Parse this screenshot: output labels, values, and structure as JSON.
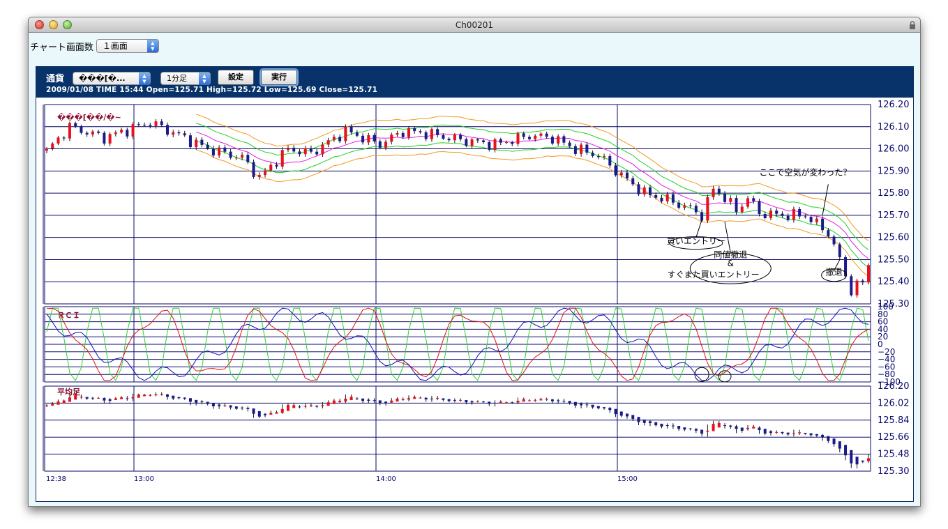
{
  "window": {
    "title": "Ch00201"
  },
  "toolbar": {
    "screen_count_label": "チャート画面数",
    "screen_count_value": "１画面"
  },
  "header": {
    "currency_label": "通貨",
    "currency_value": "���[�...",
    "timeframe_value": "1分足",
    "settings_button": "設定",
    "run_button": "実行",
    "info": "2009/01/08  TIME 15:44  Open=125.71   High=125.72   Low=125.69   Close=125.71"
  },
  "colors": {
    "bull": "#e8101a",
    "bear": "#1a1a8c",
    "ma_orange": "#f09a20",
    "ma_green": "#20d020",
    "ma_magenta": "#e020e0",
    "rci_red": "#e01010",
    "rci_green": "#30d030",
    "rci_blue": "#1010c0",
    "header_bg": "#07336a",
    "label": "#8b1030"
  },
  "chart_data": [
    {
      "type": "candlestick",
      "title": "���[��/�~",
      "y_ticks": [
        "126.20",
        "126.10",
        "126.00",
        "125.90",
        "125.80",
        "125.70",
        "125.60",
        "125.50",
        "125.40",
        "125.30"
      ],
      "ylim": [
        125.3,
        126.2
      ],
      "x_labels": [
        "12:38",
        "13:00",
        "14:00",
        "15:00"
      ],
      "annotations": [
        {
          "text": "ここで空気が変わった？",
          "t": 132,
          "price": 125.88
        },
        {
          "text": "買いエントリー",
          "t": 113,
          "price": 125.57
        },
        {
          "text": "同値撤退",
          "t": 119,
          "price": 125.51
        },
        {
          "text": "&",
          "t": 119,
          "price": 125.47
        },
        {
          "text": "すぐまた買いエントリー",
          "t": 116,
          "price": 125.42
        },
        {
          "text": "撤退",
          "t": 137,
          "price": 125.43
        }
      ]
    },
    {
      "type": "line",
      "title": "ＲＣＩ",
      "y_ticks": [
        "100",
        "80",
        "60",
        "40",
        "20",
        "0",
        "−20",
        "−40",
        "−60",
        "−80",
        "−100"
      ],
      "ylim": [
        -100,
        100
      ],
      "series": []
    },
    {
      "type": "candlestick",
      "title": "平均足",
      "y_ticks": [
        "126.20",
        "126.02",
        "125.84",
        "125.66",
        "125.48",
        "125.30"
      ],
      "ylim": [
        125.3,
        126.2
      ]
    }
  ]
}
